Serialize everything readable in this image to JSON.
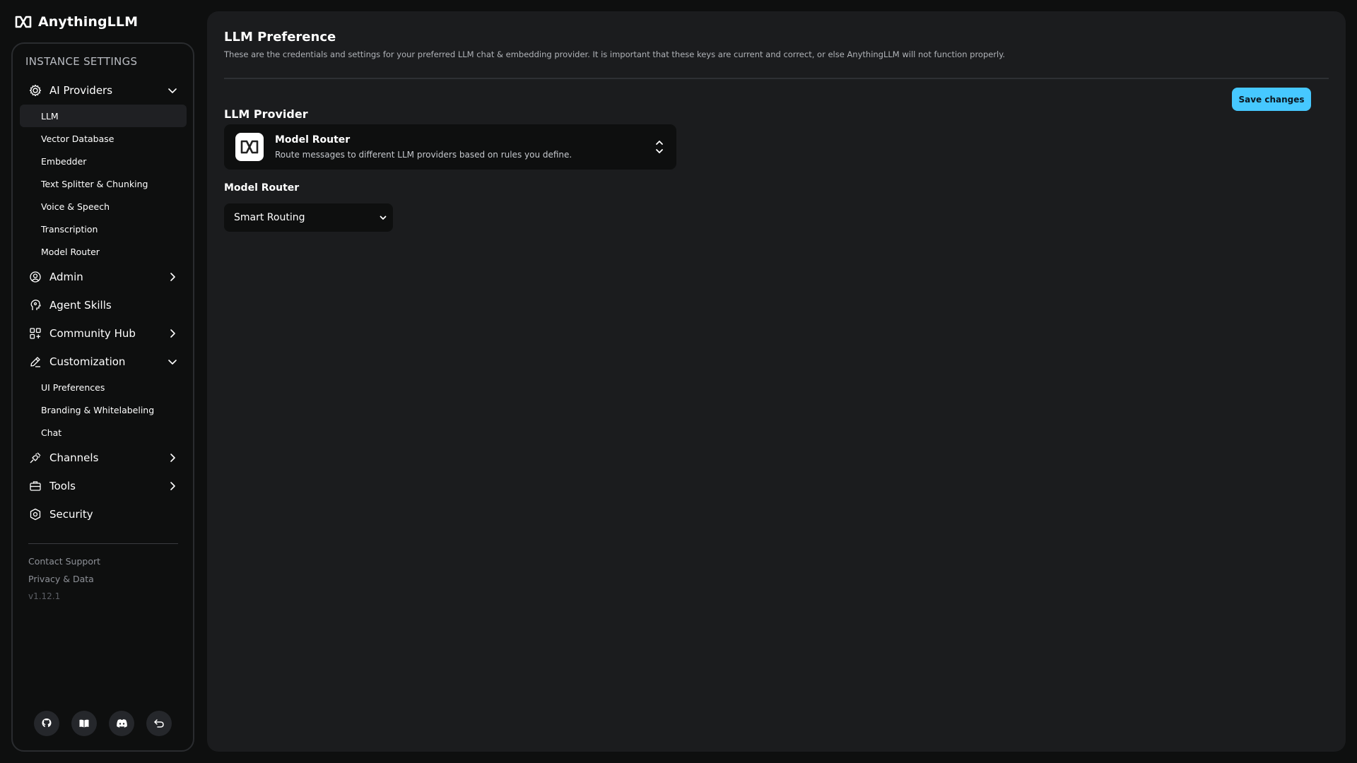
{
  "brand": {
    "name": "AnythingLLM"
  },
  "sidebar": {
    "section_title": "INSTANCE SETTINGS",
    "items": [
      {
        "label": "AI Providers",
        "icon": "gear-icon",
        "expanded": true,
        "children": [
          "LLM",
          "Vector Database",
          "Embedder",
          "Text Splitter & Chunking",
          "Voice & Speech",
          "Transcription",
          "Model Router"
        ]
      },
      {
        "label": "Admin",
        "icon": "user-gear-icon"
      },
      {
        "label": "Agent Skills",
        "icon": "robot-icon"
      },
      {
        "label": "Community Hub",
        "icon": "grid-icon"
      },
      {
        "label": "Customization",
        "icon": "pencil-icon",
        "expanded": true,
        "children": [
          "UI Preferences",
          "Branding & Whitelabeling",
          "Chat"
        ]
      },
      {
        "label": "Channels",
        "icon": "plug-icon"
      },
      {
        "label": "Tools",
        "icon": "toolbox-icon"
      },
      {
        "label": "Security",
        "icon": "shield-icon"
      }
    ],
    "active_child": "LLM",
    "footer": {
      "contact": "Contact Support",
      "privacy": "Privacy & Data",
      "version": "v1.12.1"
    },
    "bottom_icons": [
      "github-icon",
      "book-icon",
      "discord-icon",
      "back-arrow-icon"
    ]
  },
  "main": {
    "title": "LLM Preference",
    "description": "These are the credentials and settings for your preferred LLM chat & embedding provider. It is important that these keys are current and correct, or else AnythingLLM will not function properly.",
    "save_label": "Save changes",
    "provider_heading": "LLM Provider",
    "provider": {
      "name": "Model Router",
      "description": "Route messages to different LLM providers based on rules you define."
    },
    "router_label": "Model Router",
    "router_select_value": "Smart Routing"
  },
  "colors": {
    "accent": "#46c8ff",
    "background": "#0e0f0f",
    "panel": "#1b1c1e"
  }
}
